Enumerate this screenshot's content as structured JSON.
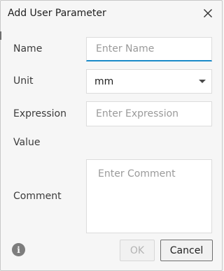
{
  "dialog": {
    "title": "Add User Parameter"
  },
  "form": {
    "name_label": "Name",
    "name_placeholder": "Enter Name",
    "name_value": "",
    "unit_label": "Unit",
    "unit_value": "mm",
    "expression_label": "Expression",
    "expression_placeholder": "Enter Expression",
    "expression_value": "",
    "value_label": "Value",
    "value_text": "",
    "comment_label": "Comment",
    "comment_placeholder": "Enter Comment",
    "comment_value": ""
  },
  "buttons": {
    "ok_label": "OK",
    "cancel_label": "Cancel"
  },
  "icons": {
    "close": "close-icon",
    "info": "info-icon",
    "dropdown": "chevron-down-icon"
  },
  "colors": {
    "focus_accent": "#1a8ac9",
    "background": "#f6f6f6"
  }
}
